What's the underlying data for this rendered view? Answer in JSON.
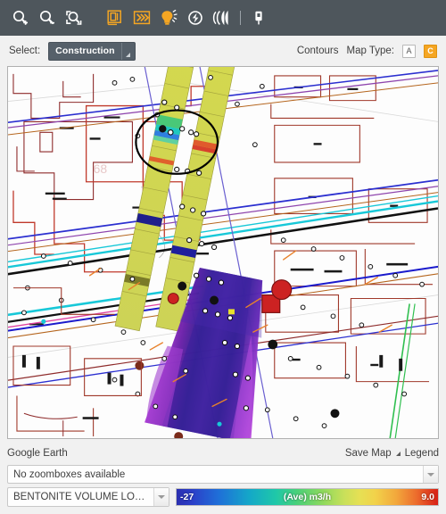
{
  "toolbar": {
    "buttons": [
      {
        "name": "zoom-in-icon",
        "title": "Zoom In"
      },
      {
        "name": "zoom-out-icon",
        "title": "Zoom Out"
      },
      {
        "name": "zoom-extent-icon",
        "title": "Zoom To Extent"
      },
      {
        "name": "layers-panel-icon",
        "title": "Layers"
      },
      {
        "name": "chevrons-right-icon",
        "title": "Advance"
      },
      {
        "name": "lightbulb-icon",
        "title": "Highlight"
      },
      {
        "name": "flash-icon",
        "title": "Flash"
      },
      {
        "name": "rings-icon",
        "title": "Contours"
      },
      {
        "name": "marker-pin-icon",
        "title": "Place Marker"
      }
    ]
  },
  "selectbar": {
    "select_label": "Select:",
    "selected_value": "Construction",
    "contours_label": "Contours",
    "map_type_label": "Map Type:",
    "map_type_options": [
      "A",
      "C"
    ],
    "map_type_active": "C"
  },
  "map": {
    "annotation_label": "68"
  },
  "bottom": {
    "google_earth_label": "Google Earth",
    "save_map_label": "Save Map",
    "legend_label": "Legend",
    "zoombox_value": "No zoomboxes available",
    "parameter_value": "BENTONITE VOLUME LOOSENING...",
    "colorbar": {
      "min": "-27",
      "max": "9.0",
      "unit": "(Ave) m3/h"
    }
  },
  "chart_data": {
    "type": "heatmap",
    "title": "BENTONITE VOLUME LOOSENING...",
    "unit": "(Ave) m3/h",
    "colorbar_min": -27,
    "colorbar_max": 9.0,
    "colorbar_stops": [
      "#2b2fb0",
      "#1f6fd8",
      "#14a8c8",
      "#1fc8a8",
      "#8fd95c",
      "#e6e054",
      "#f2a83c",
      "#d81f16"
    ],
    "legend_position": "bottom"
  }
}
